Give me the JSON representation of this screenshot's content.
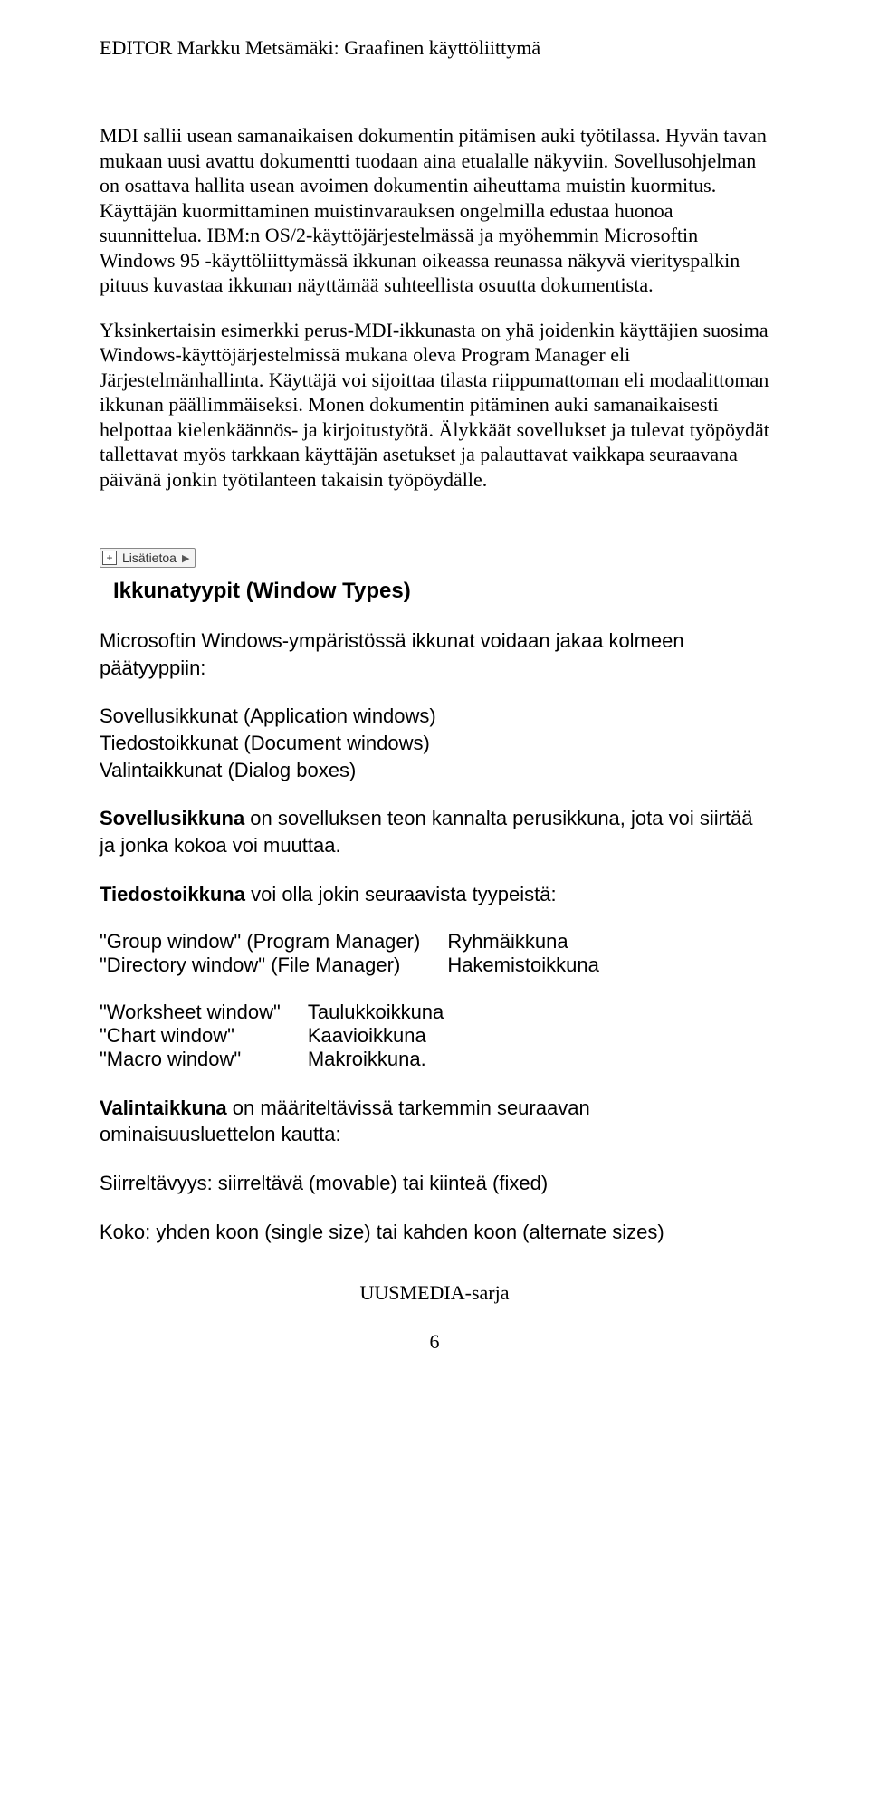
{
  "header": "EDITOR  Markku Metsämäki: Graafinen käyttöliittymä",
  "p1": "MDI sallii usean samanaikaisen dokumentin pitämisen auki työtilassa. Hyvän tavan mukaan uusi avattu dokumentti tuodaan aina etualalle näkyviin. Sovellusohjelman on osattava hallita usean avoimen dokumentin aiheuttama muistin kuormitus. Käyttäjän kuormittaminen muistinvarauksen ongelmilla edustaa huonoa suunnittelua. IBM:n OS/2-käyttöjärjestelmässä ja myöhemmin Microsoftin Windows 95 -käyttöliittymässä ikkunan oikeassa reunassa näkyvä vierityspalkin pituus kuvastaa ikkunan näyttämää suhteellista osuutta dokumentista.",
  "p2": "Yksinkertaisin esimerkki perus-MDI-ikkunasta on yhä joidenkin käyttäjien suosima Windows-käyttöjärjestelmissä mukana oleva Program Manager eli Järjestelmänhallinta. Käyttäjä voi sijoittaa tilasta riippumattoman eli modaalittoman ikkunan päällimmäiseksi. Monen dokumentin pitäminen auki samanaikaisesti helpottaa kielenkäännös- ja kirjoitustyötä. Älykkäät sovellukset ja tulevat työpöydät tallettavat myös tarkkaan käyttäjän asetukset ja palauttavat vaikkapa seuraavana päivänä jonkin työtilanteen takaisin työpöydälle.",
  "widget_label": "Lisätietoa",
  "section_title": "Ikkunatyypit (Window Types)",
  "intro": "Microsoftin Windows-ympäristössä ikkunat voidaan jakaa kolmeen päätyyppiin:",
  "list": {
    "a": "Sovellusikkunat (Application windows)",
    "b": "Tiedostoikkunat (Document windows)",
    "c": "Valintaikkunat (Dialog boxes)"
  },
  "sov": {
    "bold": "Sovellusikkuna",
    "rest": " on sovelluksen teon kannalta perusikkuna, jota voi siirtää ja jonka kokoa voi muuttaa."
  },
  "tied": {
    "bold": "Tiedostoikkuna",
    "rest": " voi olla jokin seuraavista tyypeistä:"
  },
  "table1": [
    {
      "l": "\"Group window\" (Program Manager)",
      "r": "Ryhmäikkuna"
    },
    {
      "l": "\"Directory window\" (File Manager)",
      "r": "Hakemistoikkuna"
    }
  ],
  "table2": [
    {
      "l": "\"Worksheet window\"",
      "r": "Taulukkoikkuna"
    },
    {
      "l": "\"Chart window\"",
      "r": "Kaavioikkuna"
    },
    {
      "l": "\"Macro window\"",
      "r": "Makroikkuna."
    }
  ],
  "val": {
    "bold": "Valintaikkuna",
    "rest": " on määriteltävissä tarkemmin seuraavan ominaisuusluettelon kautta:"
  },
  "prop1": "Siirreltävyys: siirreltävä (movable) tai kiinteä (fixed)",
  "prop2": "Koko: yhden koon (single size) tai kahden koon (alternate sizes)",
  "footer": "UUSMEDIA-sarja",
  "page_number": "6"
}
